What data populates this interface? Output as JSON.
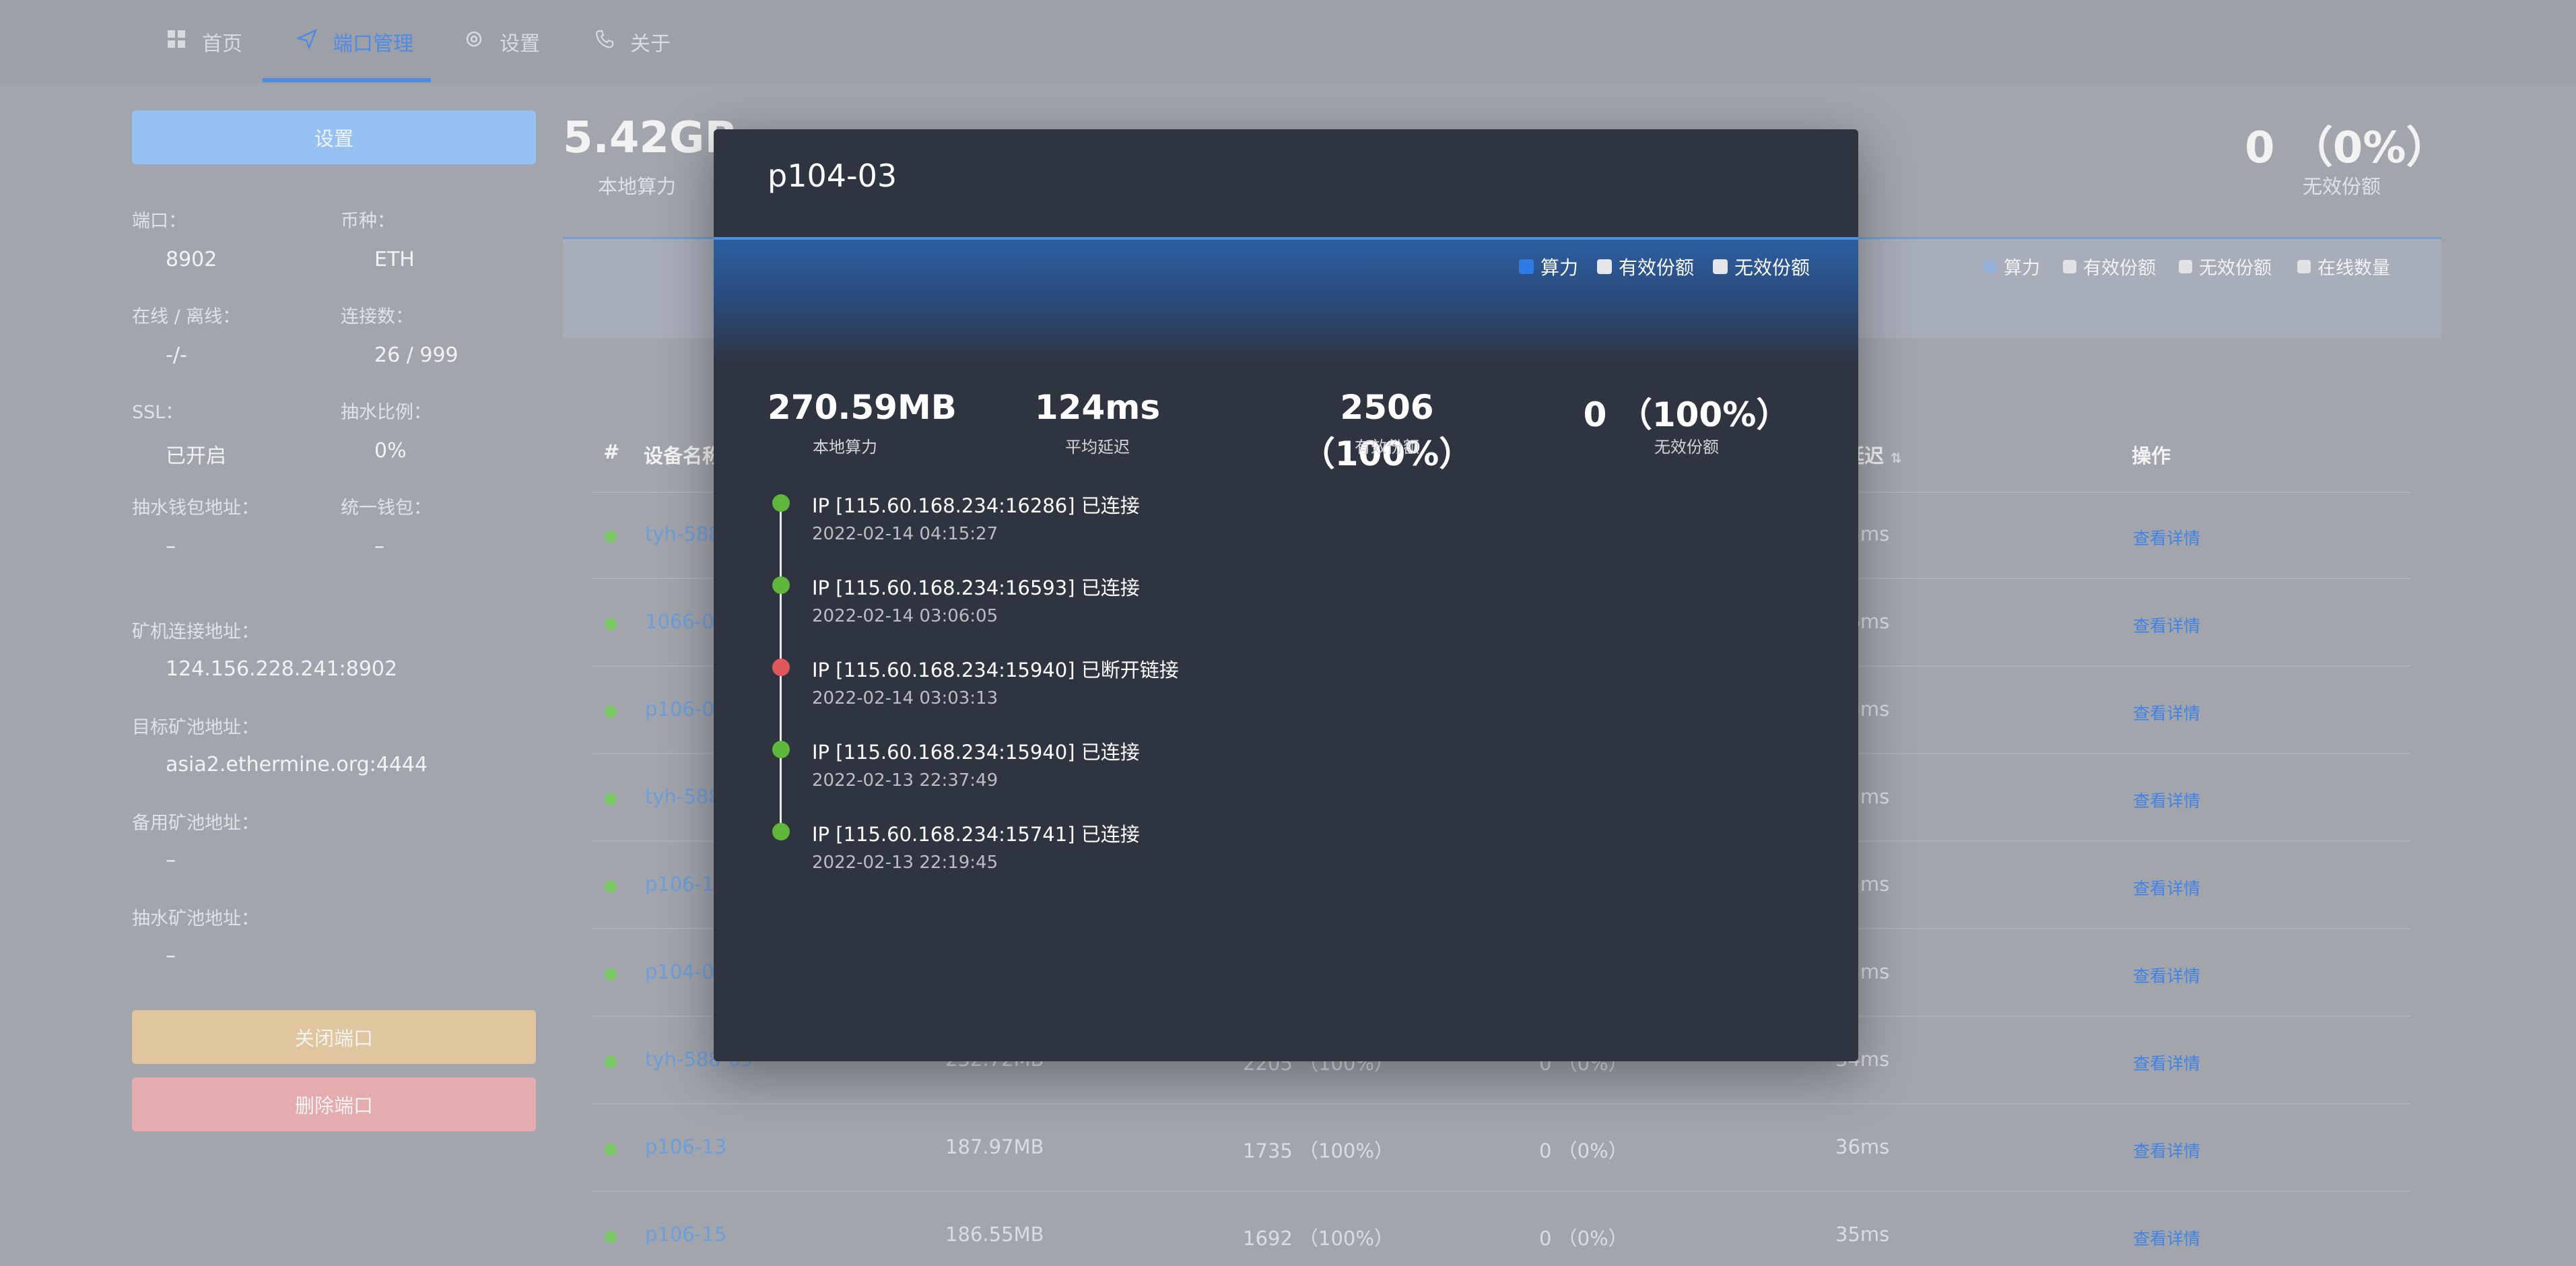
{
  "nav": {
    "items": [
      {
        "icon": "grid-icon",
        "label": "首页"
      },
      {
        "icon": "paper-plane-icon",
        "label": "端口管理"
      },
      {
        "icon": "gear-icon",
        "label": "设置"
      },
      {
        "icon": "phone-icon",
        "label": "关于"
      }
    ]
  },
  "left": {
    "settings_button": "设置",
    "port_label": "端口：",
    "port_value": "8902",
    "coin_label": "币种：",
    "coin_value": "ETH",
    "online_label": "在线 / 离线：",
    "online_value": "-/-",
    "conn_label": "连接数：",
    "conn_value": "26 / 999",
    "ssl_label": "SSL：",
    "ssl_value": "已开启",
    "fee_label": "抽水比例：",
    "fee_value": "0%",
    "fee_wallet_label": "抽水钱包地址：",
    "fee_wallet_value": "–",
    "unified_wallet_label": "统一钱包：",
    "unified_wallet_value": "–",
    "miner_addr_label": "矿机连接地址：",
    "miner_addr_value": "124.156.228.241:8902",
    "target_pool_label": "目标矿池地址：",
    "target_pool_value": "asia2.ethermine.org:4444",
    "backup_pool_label": "备用矿池地址：",
    "backup_pool_value": "–",
    "fee_pool_label": "抽水矿池地址：",
    "fee_pool_value": "–",
    "close_button": "关闭端口",
    "delete_button": "删除端口"
  },
  "bg_stats": {
    "hashrate_value": "5.42GB",
    "hashrate_label": "本地算力",
    "invalid_value": "0 （0%）",
    "invalid_label": "无效份额",
    "legend": [
      "算力",
      "有效份额",
      "无效份额",
      "在线数量"
    ]
  },
  "table": {
    "headers": {
      "index": "#",
      "device": "设备名称",
      "delay": "延迟",
      "action": "操作"
    },
    "rows": [
      {
        "name": "tyh-588-",
        "hashrate": "",
        "valid": "",
        "invalid": "",
        "delay": "35ms",
        "action": "查看详情"
      },
      {
        "name": "1066-02",
        "hashrate": "",
        "valid": "",
        "invalid": "",
        "delay": "36ms",
        "action": "查看详情"
      },
      {
        "name": "p106-09",
        "hashrate": "",
        "valid": "",
        "invalid": "",
        "delay": "35ms",
        "action": "查看详情"
      },
      {
        "name": "tyh-588-",
        "hashrate": "",
        "valid": "",
        "invalid": "",
        "delay": "35ms",
        "action": "查看详情"
      },
      {
        "name": "p106-11",
        "hashrate": "",
        "valid": "",
        "invalid": "",
        "delay": "35ms",
        "action": "查看详情"
      },
      {
        "name": "p104-01",
        "hashrate": "",
        "valid": "",
        "invalid": "",
        "delay": "35ms",
        "action": "查看详情"
      },
      {
        "name": "tyh-588-09",
        "hashrate": "232.72MB",
        "valid": "2205 （100%）",
        "invalid": "0 （0%）",
        "delay": "34ms",
        "action": "查看详情"
      },
      {
        "name": "p106-13",
        "hashrate": "187.97MB",
        "valid": "1735 （100%）",
        "invalid": "0 （0%）",
        "delay": "36ms",
        "action": "查看详情"
      },
      {
        "name": "p106-15",
        "hashrate": "186.55MB",
        "valid": "1692 （100%）",
        "invalid": "0 （0%）",
        "delay": "35ms",
        "action": "查看详情"
      }
    ]
  },
  "modal": {
    "title": "p104-03",
    "legend": [
      {
        "label": "算力",
        "color": "#2f7be6"
      },
      {
        "label": "有效份额",
        "color": "#e4e6ea"
      },
      {
        "label": "无效份额",
        "color": "#e4e6ea"
      }
    ],
    "stats": [
      {
        "value": "270.59MB",
        "label": "本地算力"
      },
      {
        "value": "124ms",
        "label": "平均延迟"
      },
      {
        "value": "2506 （100%）",
        "label": "有效份额"
      },
      {
        "value": "0 （100%）",
        "label": "无效份额"
      }
    ],
    "timeline": [
      {
        "text": "IP [115.60.168.234:16286] 已连接",
        "time": "2022-02-14 04:15:27",
        "status": "connected"
      },
      {
        "text": "IP [115.60.168.234:16593] 已连接",
        "time": "2022-02-14 03:06:05",
        "status": "connected"
      },
      {
        "text": "IP [115.60.168.234:15940] 已断开链接",
        "time": "2022-02-14 03:03:13",
        "status": "disconnected"
      },
      {
        "text": "IP [115.60.168.234:15940] 已连接",
        "time": "2022-02-13 22:37:49",
        "status": "connected"
      },
      {
        "text": "IP [115.60.168.234:15741] 已连接",
        "time": "2022-02-13 22:19:45",
        "status": "connected"
      }
    ]
  },
  "colors": {
    "accent": "#4f8ff0",
    "connected": "#5fb83c",
    "disconnected": "#e0585b",
    "online_dot": "#7ed466"
  }
}
